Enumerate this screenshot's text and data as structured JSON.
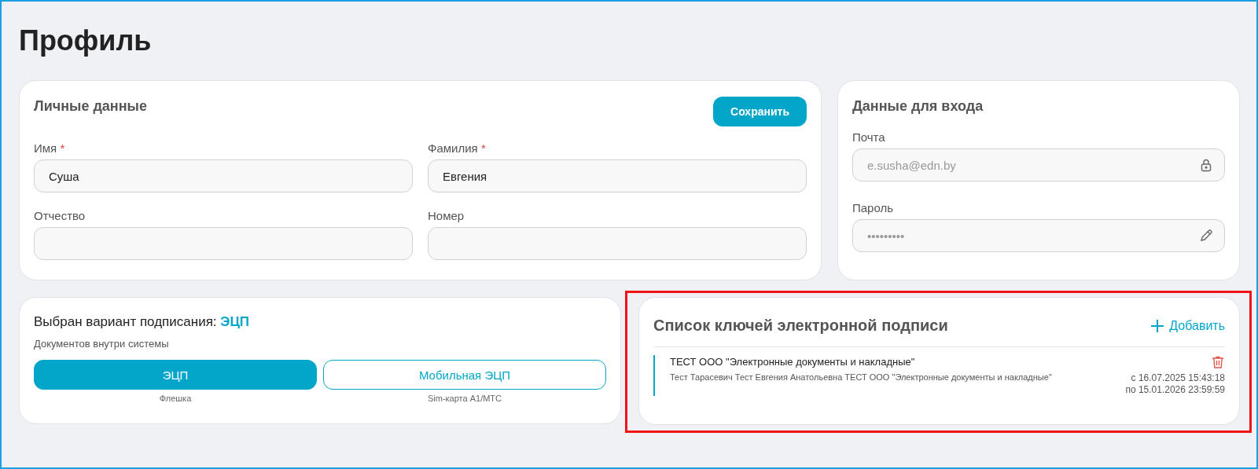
{
  "page_title": "Профиль",
  "personal": {
    "title": "Личные данные",
    "save_button": "Сохранить",
    "fields": [
      {
        "label": "Имя",
        "required_mark": "*",
        "value": "Суша"
      },
      {
        "label": "Фамилия",
        "required_mark": "*",
        "value": "Евгения"
      },
      {
        "label": "Отчество"
      },
      {
        "label": "Номер"
      }
    ]
  },
  "login": {
    "title": "Данные для входа",
    "fields": [
      {
        "label": "Почта",
        "kind": "email",
        "value": "e.susha@edn.by"
      },
      {
        "label": "Пароль",
        "kind": "password",
        "value": "•••••••••"
      }
    ]
  },
  "signing": {
    "label": "Выбран вариант подписания:",
    "method": "ЭЦП",
    "description": "Документов внутри системы",
    "options": [
      {
        "label": "ЭЦП",
        "caption": "Флешка",
        "selected": true
      },
      {
        "label": "Мобильная ЭЦП",
        "caption": "Sim-карта A1/MTC",
        "selected": false
      }
    ]
  },
  "keys": {
    "title": "Список ключей электронной подписи",
    "add_button": "Добавить",
    "highlighted": true,
    "items": [
      {
        "name": "ТЕСТ ООО \"Электронные документы и накладные\"",
        "owner": "Тест Тарасевич Тест Евгения Анатольевна ТЕСТ ООО \"Электронные документы и накладные\"",
        "valid_from": "с 16.07.2025 15:43:18",
        "valid_to": "по 15.01.2026 23:59:59"
      }
    ]
  }
}
